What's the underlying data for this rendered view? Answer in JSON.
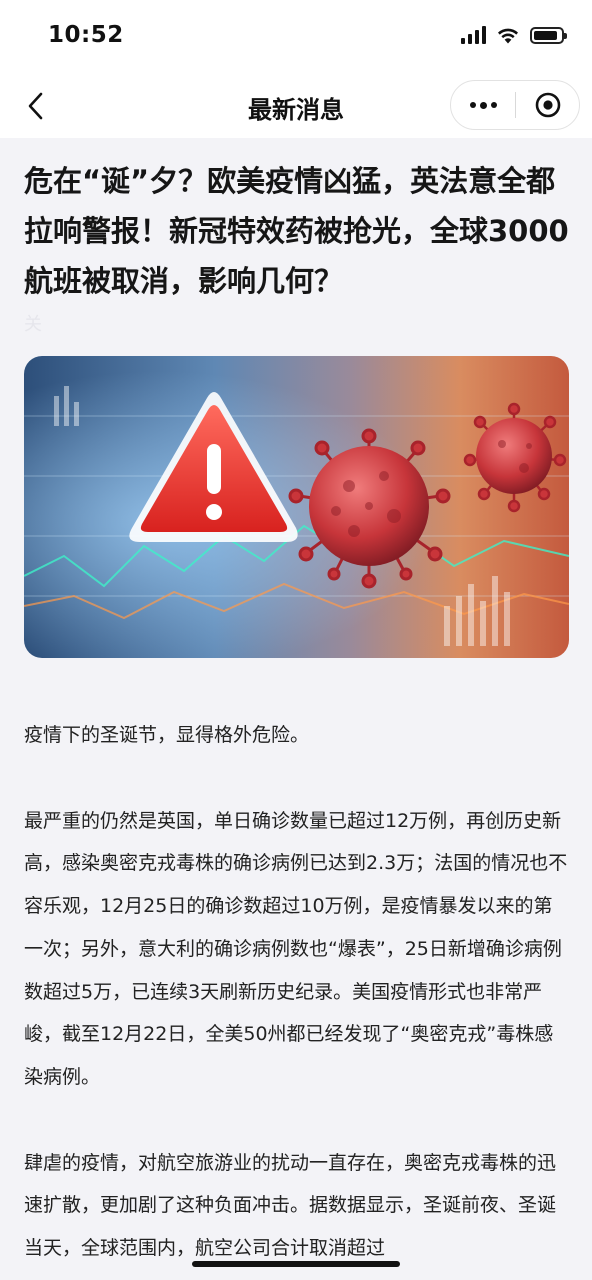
{
  "status_bar": {
    "time": "10:52",
    "signal_bars": 4,
    "wifi": "wifi-icon",
    "battery_level": 0.9
  },
  "nav": {
    "title": "最新消息",
    "back_icon": "chevron-left-icon",
    "more_icon": "more-dots-icon",
    "close_icon": "target-close-icon"
  },
  "article": {
    "title": "危在“诞”夕？欧美疫情凶猛，英法意全都拉响警报！新冠特效药被抢光，全球3000航班被取消，影响几何？",
    "author": "关",
    "image": {
      "description_icon": "warning-triangle-virus-illustration",
      "colors": {
        "warning_red": "#e8332f",
        "virus_red": "#c9353a",
        "bg_blue": "#2b5d8e"
      }
    },
    "paragraphs": [
      "疫情下的圣诞节，显得格外危险。",
      "最严重的仍然是英国，单日确诊数量已超过12万例，再创历史新高，感染奥密克戎毒株的确诊病例已达到2.3万；法国的情况也不容乐观，12月25日的确诊数超过10万例，是疫情暴发以来的第一次；另外，意大利的确诊病例数也“爆表”，25日新增确诊病例数超过5万，已连续3天刷新历史纪录。美国疫情形式也非常严峻，截至12月22日，全美50州都已经发现了“奥密克戎”毒株感染病例。",
      "肆虐的疫情，对航空旅游业的扰动一直存在，奥密克戎毒株的迅速扩散，更加剧了这种负面冲击。据数据显示，圣诞前夜、圣诞当天，全球范围内，航空公司合计取消超过"
    ]
  }
}
